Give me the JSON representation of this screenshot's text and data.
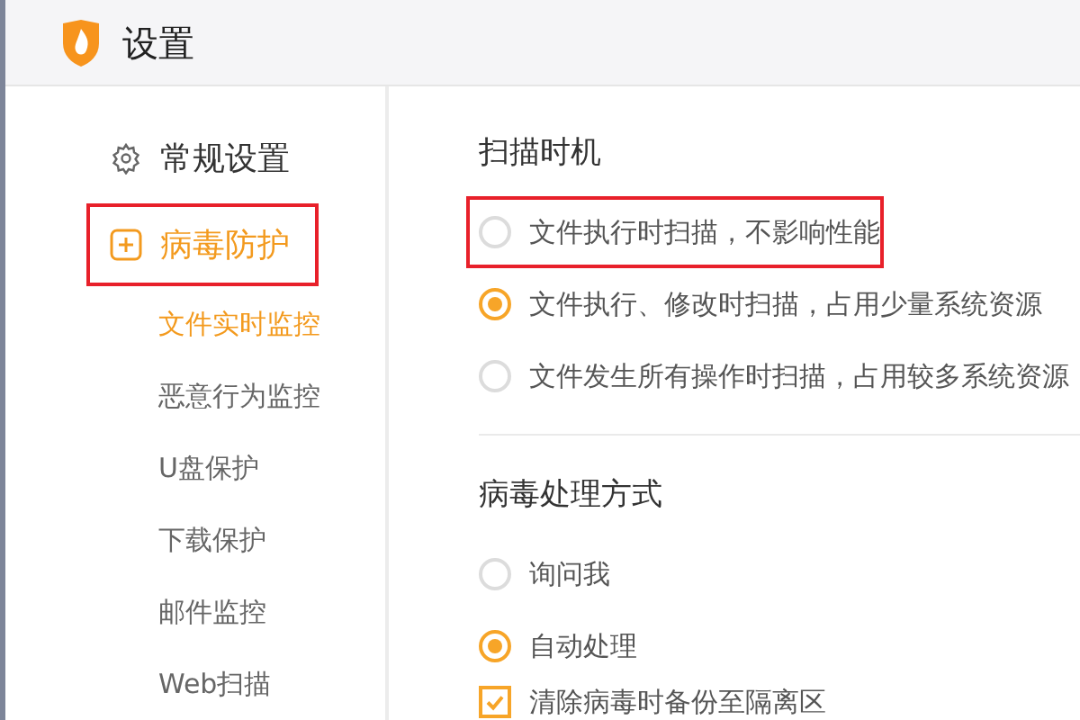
{
  "window": {
    "title": "设置"
  },
  "sidebar": {
    "items": [
      {
        "label": "常规设置",
        "kind": "gear",
        "selected": false,
        "annotated": false
      },
      {
        "label": "病毒防护",
        "kind": "plus",
        "selected": true,
        "annotated": true,
        "children": [
          {
            "label": "文件实时监控",
            "selected": true
          },
          {
            "label": "恶意行为监控",
            "selected": false
          },
          {
            "label": "U盘保护",
            "selected": false
          },
          {
            "label": "下载保护",
            "selected": false
          },
          {
            "label": "邮件监控",
            "selected": false
          },
          {
            "label": "Web扫描",
            "selected": false
          }
        ]
      }
    ]
  },
  "sections": [
    {
      "title": "扫描时机",
      "options": [
        {
          "kind": "radio",
          "label": "文件执行时扫描，不影响性能",
          "selected": false,
          "annotated": true
        },
        {
          "kind": "radio",
          "label": "文件执行、修改时扫描，占用少量系统资源",
          "selected": true,
          "annotated": false
        },
        {
          "kind": "radio",
          "label": "文件发生所有操作时扫描，占用较多系统资源",
          "selected": false,
          "annotated": false
        }
      ]
    },
    {
      "title": "病毒处理方式",
      "options": [
        {
          "kind": "radio",
          "label": "询问我",
          "selected": false,
          "annotated": false
        },
        {
          "kind": "radio",
          "label": "自动处理",
          "selected": true,
          "annotated": false
        },
        {
          "kind": "checkbox",
          "label": "清除病毒时备份至隔离区",
          "checked": true,
          "annotated": false
        }
      ]
    }
  ]
}
